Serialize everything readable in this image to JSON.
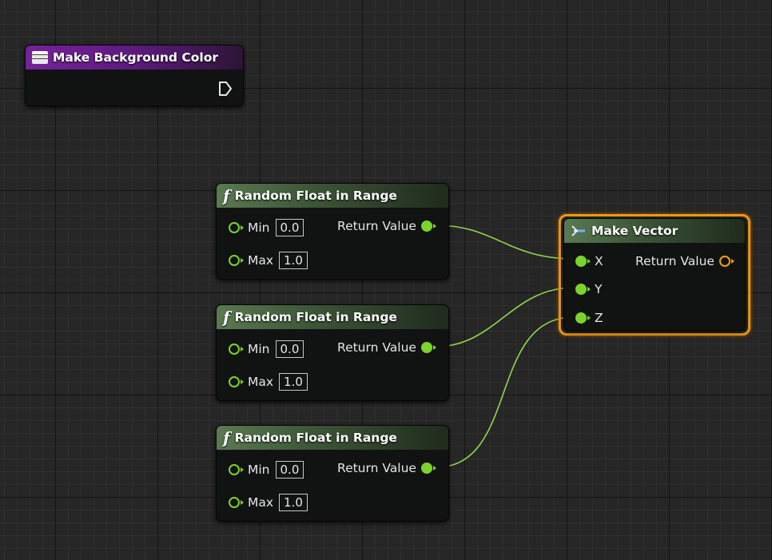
{
  "background_node": {
    "title": "Make Background Color"
  },
  "random_nodes": [
    {
      "title": "Random Float in Range",
      "min_label": "Min",
      "min_value": "0.0",
      "max_label": "Max",
      "max_value": "1.0",
      "return_label": "Return Value"
    },
    {
      "title": "Random Float in Range",
      "min_label": "Min",
      "min_value": "0.0",
      "max_label": "Max",
      "max_value": "1.0",
      "return_label": "Return Value"
    },
    {
      "title": "Random Float in Range",
      "min_label": "Min",
      "min_value": "0.0",
      "max_label": "Max",
      "max_value": "1.0",
      "return_label": "Return Value"
    }
  ],
  "make_vector": {
    "title": "Make Vector",
    "x_label": "X",
    "y_label": "Y",
    "z_label": "Z",
    "return_label": "Return Value"
  },
  "colors": {
    "float_pin": "#7bd42c",
    "vector_pin": "#f0a30a",
    "selection": "#f29b11",
    "struct_header": "#74239a",
    "function_header": "#5a7a52"
  },
  "icons": {
    "function": "function-icon",
    "struct": "struct-icon",
    "make": "make-icon",
    "exec": "exec-pin-icon"
  }
}
